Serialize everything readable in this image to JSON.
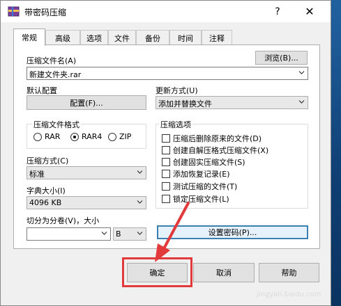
{
  "window": {
    "title": "带密码压缩",
    "help": "?",
    "close": "✕"
  },
  "tabs": [
    "常规",
    "高级",
    "选项",
    "文件",
    "备份",
    "时间",
    "注释"
  ],
  "general": {
    "archive_name_label": "压缩文件名(A)",
    "browse_label": "浏览(B)...",
    "archive_name_value": "新建文件夹.rar",
    "default_profile_label": "默认配置",
    "profile_button": "配置(F)...",
    "update_mode_label": "更新方式(U)",
    "update_mode_value": "添加并替换文件",
    "format_group_label": "压缩文件格式",
    "formats": [
      {
        "label": "RAR",
        "selected": false
      },
      {
        "label": "RAR4",
        "selected": true
      },
      {
        "label": "ZIP",
        "selected": false
      }
    ],
    "method_label": "压缩方式(C)",
    "method_value": "标准",
    "dict_label": "字典大小(I)",
    "dict_value": "4096 KB",
    "split_label": "切分为分卷(V)，大小",
    "split_value": "",
    "split_unit": "B",
    "options_group_label": "压缩选项",
    "options": [
      "压缩后删除原来的文件(D)",
      "创建自解压格式压缩文件(X)",
      "创建固实压缩文件(S)",
      "添加恢复记录(E)",
      "测试压缩的文件(T)",
      "锁定压缩文件(L)"
    ],
    "set_password_button": "设置密码(P)..."
  },
  "footer": {
    "ok": "确定",
    "cancel": "取消",
    "help": "帮助"
  },
  "watermark": "jingyan.baidu.com",
  "colors": {
    "highlight": "#e23a3a",
    "focus_border": "#3c7fb1"
  }
}
